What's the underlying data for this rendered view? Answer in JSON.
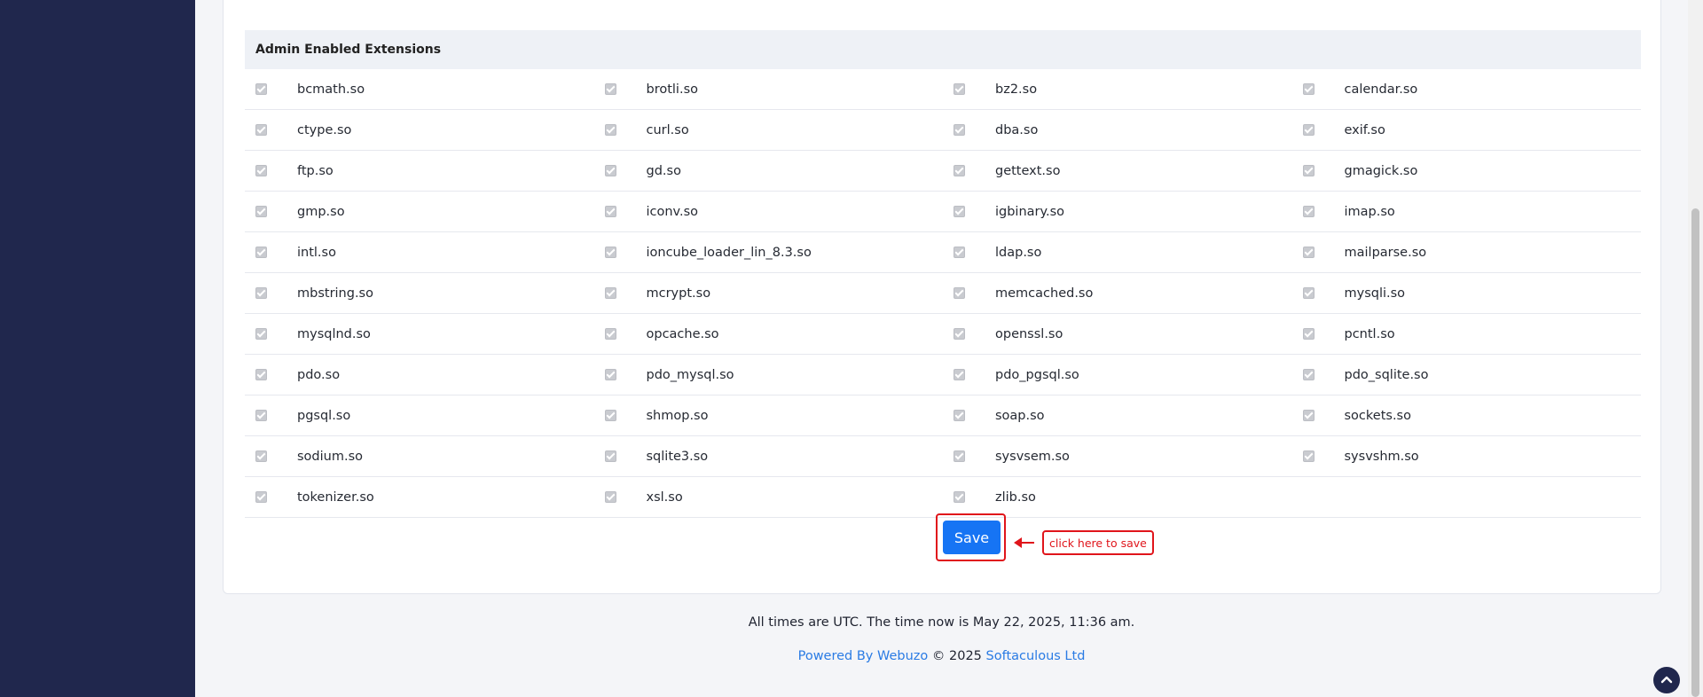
{
  "section": {
    "title": "Admin Enabled Extensions"
  },
  "extensions": [
    [
      "bcmath.so",
      "brotli.so",
      "bz2.so",
      "calendar.so"
    ],
    [
      "ctype.so",
      "curl.so",
      "dba.so",
      "exif.so"
    ],
    [
      "ftp.so",
      "gd.so",
      "gettext.so",
      "gmagick.so"
    ],
    [
      "gmp.so",
      "iconv.so",
      "igbinary.so",
      "imap.so"
    ],
    [
      "intl.so",
      "ioncube_loader_lin_8.3.so",
      "ldap.so",
      "mailparse.so"
    ],
    [
      "mbstring.so",
      "mcrypt.so",
      "memcached.so",
      "mysqli.so"
    ],
    [
      "mysqlnd.so",
      "opcache.so",
      "openssl.so",
      "pcntl.so"
    ],
    [
      "pdo.so",
      "pdo_mysql.so",
      "pdo_pgsql.so",
      "pdo_sqlite.so"
    ],
    [
      "pgsql.so",
      "shmop.so",
      "soap.so",
      "sockets.so"
    ],
    [
      "sodium.so",
      "sqlite3.so",
      "sysvsem.so",
      "sysvshm.so"
    ],
    [
      "tokenizer.so",
      "xsl.so",
      "zlib.so"
    ]
  ],
  "actions": {
    "save_label": "Save",
    "callout": "click here to save"
  },
  "footer": {
    "time_text": "All times are UTC. The time now is May 22, 2025, 11:36 am.",
    "powered_by": "Powered By Webuzo",
    "copyright": "© 2025",
    "company": "Softaculous Ltd"
  },
  "icons": {
    "scroll_top": "chevron-up-icon",
    "checkbox": "checkmark-icon",
    "annotation_arrow": "arrow-left-icon"
  },
  "colors": {
    "sidebar": "#20274d",
    "primary": "#1674f4",
    "annotation": "#e0151b",
    "link": "#2a7be4"
  }
}
